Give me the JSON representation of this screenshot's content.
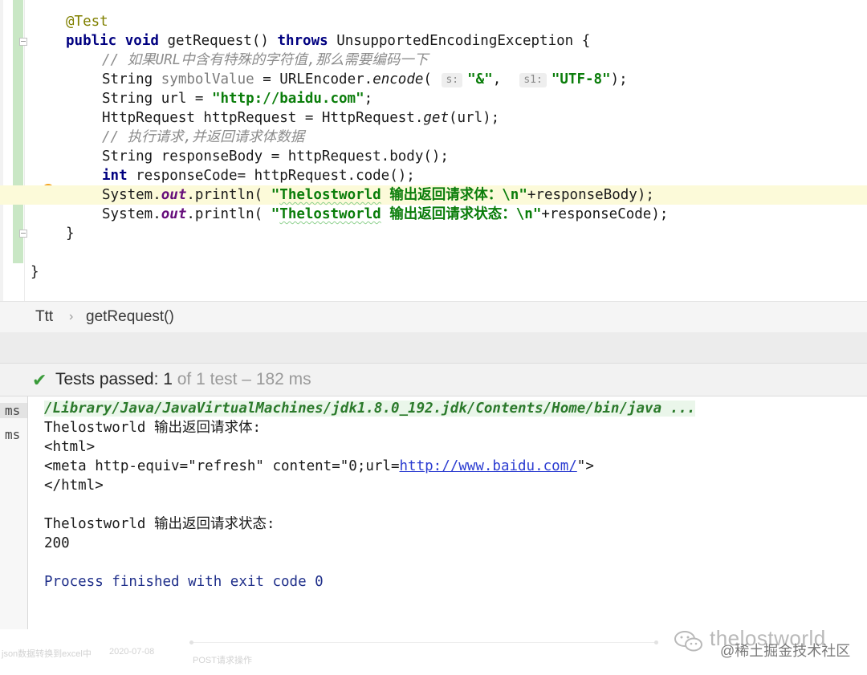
{
  "editor": {
    "annotation": "@Test",
    "line_signature": {
      "kw_public": "public",
      "kw_void": "void",
      "method": " getRequest() ",
      "kw_throws": "throws",
      "rest": " UnsupportedEncodingException {"
    },
    "comment_1": "// 如果URL中含有特殊的字符值,那么需要编码一下",
    "line_encode": {
      "a": "String ",
      "var": "symbolValue",
      "b": " = URLEncoder.",
      "fn": "encode",
      "c": "( ",
      "hint_s": "s:",
      "str1": "\"&\"",
      "d": ",  ",
      "hint_s1": "s1:",
      "str2": "\"UTF-8\"",
      "e": ");"
    },
    "line_url": {
      "a": "String url = ",
      "str": "\"http://baidu.com\"",
      "b": ";"
    },
    "line_get": {
      "a": "HttpRequest httpRequest = HttpRequest.",
      "fn": "get",
      "b": "(url);"
    },
    "comment_2": "// 执行请求,并返回请求体数据",
    "line_body": "String responseBody = httpRequest.body();",
    "line_code": {
      "kw": "int",
      "rest": " responseCode= httpRequest.code();"
    },
    "println_1": {
      "a": "System.",
      "fld": "out",
      "b": ".println( ",
      "q1": "\"",
      "name": "Thelostworld",
      "txt": " 输出返回请求体：\\n\"",
      "c": "+responseBody);"
    },
    "println_2": {
      "a": "System.",
      "fld": "out",
      "b": ".println( ",
      "q1": "\"",
      "name": "Thelostworld",
      "txt": " 输出返回请求状态：\\n\"",
      "c": "+responseCode);"
    },
    "close_method": "}",
    "close_class": "}"
  },
  "breadcrumb": {
    "class": "Ttt",
    "sep": "›",
    "method": "getRequest()"
  },
  "test_status": {
    "check_icon": "✔",
    "label": "Tests passed: ",
    "passed_count": "1",
    "rest": " of 1 test – 182 ms"
  },
  "console": {
    "side_items": [
      "ms",
      "ms"
    ],
    "java_path": "/Library/Java/JavaVirtualMachines/jdk1.8.0_192.jdk/Contents/Home/bin/java ...",
    "out_body_title": "Thelostworld 输出返回请求体:",
    "html_open": "<html>",
    "meta_prefix": "<meta http-equiv=\"refresh\" content=\"0;url=",
    "meta_link": "http://www.baidu.com/",
    "meta_suffix": "\">",
    "html_close": "</html>",
    "out_status_title": "Thelostworld 输出返回请求状态:",
    "status_code": "200",
    "process_finished": "Process finished with exit code 0"
  },
  "watermark": {
    "primary": "thelostworld",
    "secondary": "@稀土掘金技术社区",
    "icon": "wechat-icon"
  },
  "faint_text": {
    "left": "json数据转换到excel中",
    "left_meta": "2020-07-08",
    "mid": "POST请求操作"
  },
  "colors": {
    "keyword": "#000080",
    "string": "#0a7d0a",
    "annotation": "#808000",
    "comment": "#8c8c8c",
    "field": "#660e7a",
    "pass": "#3a9b3a",
    "link": "#2c3dd1"
  }
}
